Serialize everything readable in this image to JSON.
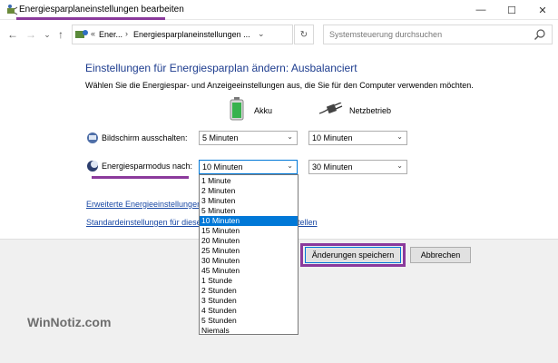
{
  "window": {
    "title": "Energiesparplaneinstellungen bearbeiten",
    "controls": {
      "minimize": "—",
      "maximize": "☐",
      "close": "✕"
    }
  },
  "nav": {
    "back": "←",
    "forward": "→",
    "dropdown": "⌄",
    "up": "↑",
    "address": {
      "prefix": "«",
      "crumb1": "Ener...",
      "crumb2": "Energiesparplaneinstellungen ...",
      "sep": "›",
      "history": "⌄",
      "refresh": "↻"
    },
    "search_placeholder": "Systemsteuerung durchsuchen"
  },
  "main": {
    "heading": "Einstellungen für Energiesparplan ändern: Ausbalanciert",
    "subtitle": "Wählen Sie die Energiespar- und Anzeigeeinstellungen aus, die Sie für den Computer verwenden möchten.",
    "columns": {
      "battery": "Akku",
      "plugged": "Netzbetrieb"
    },
    "rows": {
      "display_off": {
        "label": "Bildschirm ausschalten:",
        "battery": "5 Minuten",
        "plugged": "10 Minuten"
      },
      "sleep": {
        "label": "Energiesparmodus nach:",
        "battery": "10 Minuten",
        "plugged": "30 Minuten"
      }
    },
    "links": {
      "advanced": "Erweiterte Energieeinstellungen ä",
      "advanced_tail": "",
      "restore": "Standardeinstellungen für diese",
      "restore_tail": "tellen"
    },
    "buttons": {
      "save": "Änderungen speichern",
      "cancel": "Abbrechen"
    }
  },
  "dropdown": {
    "options": [
      "1 Minute",
      "2 Minuten",
      "3 Minuten",
      "5 Minuten",
      "10 Minuten",
      "15 Minuten",
      "20 Minuten",
      "25 Minuten",
      "30 Minuten",
      "45 Minuten",
      "1 Stunde",
      "2 Stunden",
      "3 Stunden",
      "4 Stunden",
      "5 Stunden",
      "Niemals"
    ],
    "selected_index": 4
  },
  "watermark": "WinNotiz.com",
  "colors": {
    "accent": "#0078d7",
    "highlight": "#8b3a9c",
    "heading": "#1e3d8f",
    "link": "#1a49a5"
  }
}
